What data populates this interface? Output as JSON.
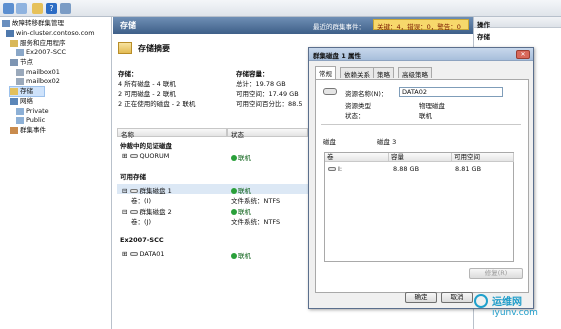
{
  "tree": {
    "root": "故障转移群集管理",
    "cluster": "win-cluster.contoso.com",
    "services": "服务和应用程序",
    "service_item": "Ex2007-SCC",
    "nodes": "节点",
    "node1": "mailbox01",
    "node2": "mailbox02",
    "storage": "存储",
    "networks": "网络",
    "net1": "Private",
    "net2": "Public",
    "events": "群集事件"
  },
  "header": {
    "title": "存储",
    "recent_label": "最近的群集事件：",
    "recent_value": "关键：4，错误：0，警告：0"
  },
  "summary": {
    "title": "存储摘要",
    "storage_label": "存储：",
    "disks_total": "4 所有磁盘 - 4 联机",
    "disks_available": "2 可用磁盘 - 2 联机",
    "disks_used": "2 正在使用的磁盘 - 2 联机",
    "capacity_label": "存储容量：",
    "total": "总计：19.78 GB",
    "free": "可用空间：17.49 GB",
    "pct": "可用空间百分比：88.5"
  },
  "table": {
    "col_name": "名称",
    "col_status": "状态",
    "group_witness": "仲裁中的见证磁盘",
    "quorum_name": "QUORUM",
    "group_available": "可用存储",
    "disk1": "群集磁盘 1",
    "disk1_vol": "卷：(I)",
    "disk2": "群集磁盘 2",
    "disk2_vol": "卷：(J)",
    "fs_label": "文件系统：NTFS",
    "group_ex": "Ex2007-SCC",
    "data_name": "DATA01",
    "online": "联机"
  },
  "actions": {
    "header": "操作",
    "sub": "存储"
  },
  "dialog": {
    "title": "群集磁盘 1 属性",
    "tabs": [
      "常规",
      "依赖关系",
      "策略",
      "高级策略"
    ],
    "res_name_label": "资源名称(N)：",
    "res_name_value": "DATA02",
    "res_type_label": "资源类型",
    "res_type_value": "物理磁盘",
    "status_label": "状态：",
    "status_value": "联机",
    "disk_label": "磁盘",
    "disk_value": "磁盘 3",
    "col_volume": "卷",
    "col_capacity": "容量",
    "col_free": "可用空间",
    "vol_name": "I:",
    "vol_capacity": "8.88 GB",
    "vol_free": "8.81 GB",
    "repair": "修复(R)",
    "ok": "确定",
    "cancel": "取消"
  },
  "watermark": {
    "line1": "运维网",
    "line2": "iyunv.com"
  }
}
